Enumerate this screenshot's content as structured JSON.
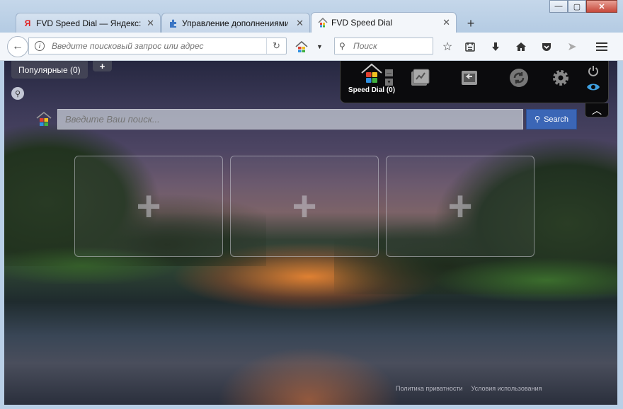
{
  "browser": {
    "tabs": [
      {
        "label": "FVD Speed Dial — Яндекс: на",
        "icon": "yandex-icon",
        "close": "✕"
      },
      {
        "label": "Управление дополнениями",
        "icon": "puzzle-icon",
        "close": "✕"
      },
      {
        "label": "FVD Speed Dial",
        "icon": "fvd-speed-dial-icon",
        "close": "✕",
        "active": true
      }
    ],
    "new_tab": "+",
    "window_controls": {
      "minimize": "—",
      "maximize": "▢",
      "close": "✕"
    },
    "address_placeholder": "Введите поисковый запрос или адрес",
    "search_placeholder": "Поиск"
  },
  "page": {
    "popular_tab": "Популярные (0)",
    "add_group": "+",
    "web_search_placeholder": "Введите Ваш поиск...",
    "search_button": "Search",
    "dials": [
      "+",
      "+",
      "+"
    ],
    "footer": {
      "privacy": "Политика приватности",
      "terms": "Условия использования"
    }
  },
  "speed_dial_panel": {
    "home_label": "Speed Dial (0)",
    "collapse": "︿"
  },
  "colors": {
    "accent": "#3b66b6",
    "panel": "#0b0b0d",
    "eye": "#3fa0e0"
  }
}
